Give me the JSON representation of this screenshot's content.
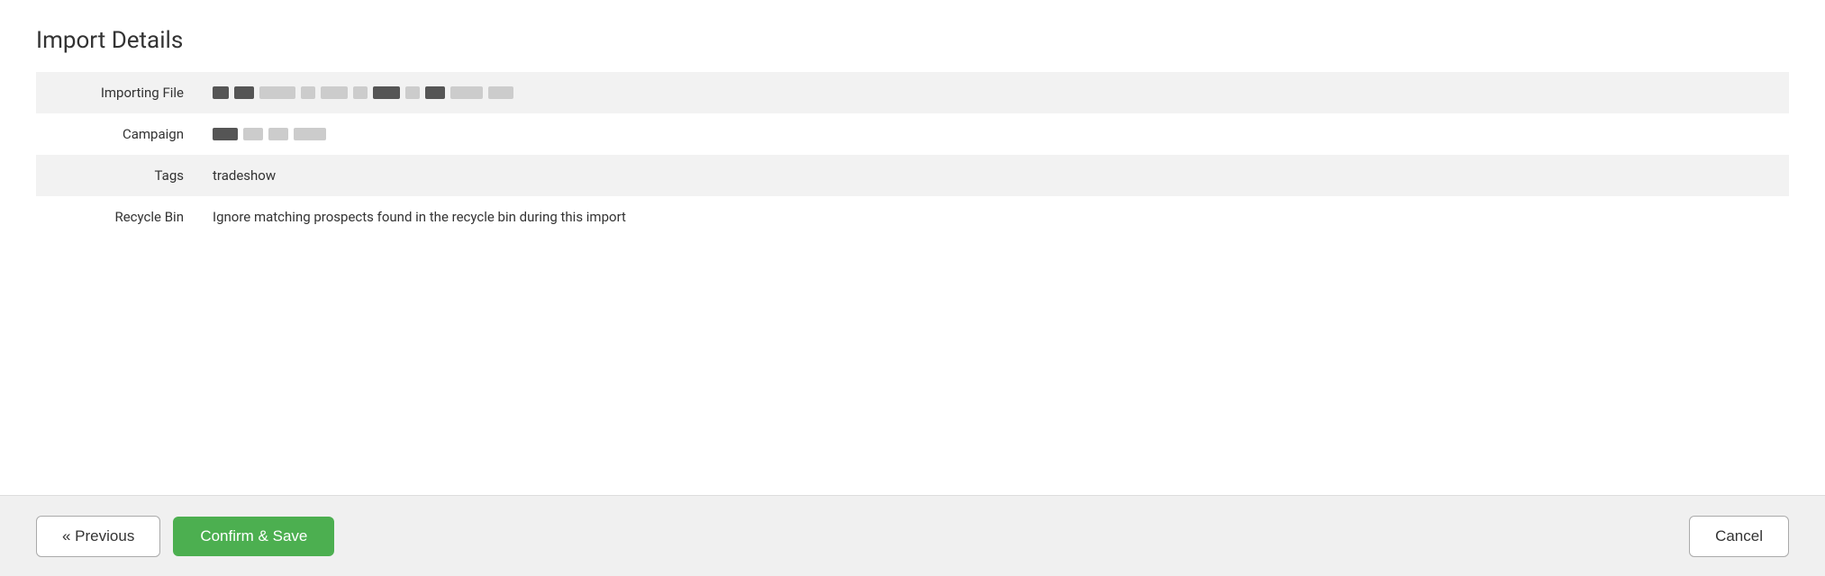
{
  "page": {
    "title": "Import Details"
  },
  "rows": [
    {
      "label": "Importing File",
      "type": "redacted-file"
    },
    {
      "label": "Campaign",
      "type": "redacted-campaign"
    },
    {
      "label": "Tags",
      "type": "text",
      "value": "tradeshow"
    },
    {
      "label": "Recycle Bin",
      "type": "text",
      "value": "Ignore matching prospects found in the recycle bin during this import"
    }
  ],
  "footer": {
    "previous_label": "« Previous",
    "confirm_label": "Confirm & Save",
    "cancel_label": "Cancel"
  }
}
